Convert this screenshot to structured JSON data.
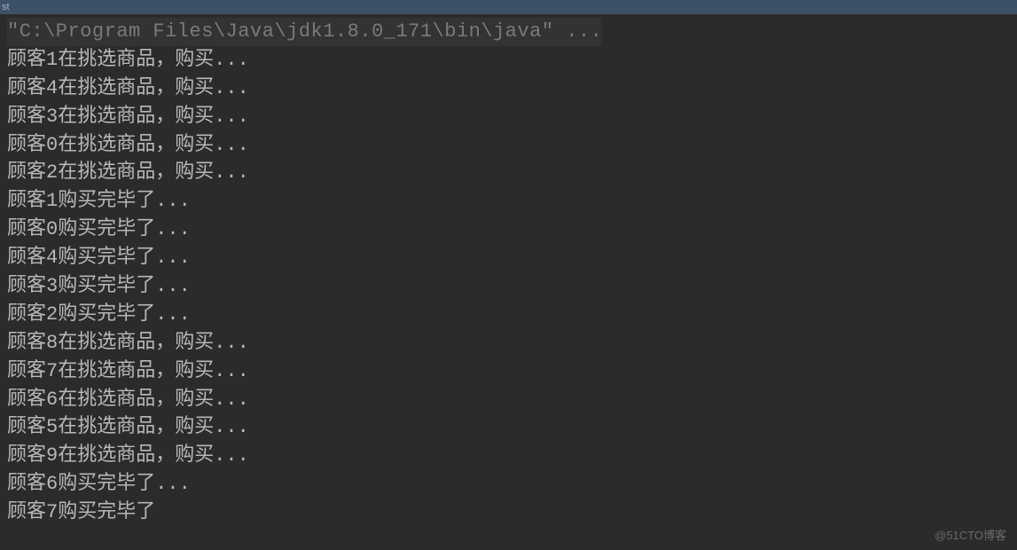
{
  "title_bar": {
    "text": "st"
  },
  "console": {
    "command": "\"C:\\Program Files\\Java\\jdk1.8.0_171\\bin\\java\" ...",
    "lines": [
      "顾客1在挑选商品，购买...",
      "顾客4在挑选商品，购买...",
      "顾客3在挑选商品，购买...",
      "顾客0在挑选商品，购买...",
      "顾客2在挑选商品，购买...",
      "顾客1购买完毕了...",
      "顾客0购买完毕了...",
      "顾客4购买完毕了...",
      "顾客3购买完毕了...",
      "顾客2购买完毕了...",
      "顾客8在挑选商品，购买...",
      "顾客7在挑选商品，购买...",
      "顾客6在挑选商品，购买...",
      "顾客5在挑选商品，购买...",
      "顾客9在挑选商品，购买...",
      "顾客6购买完毕了...",
      "顾客7购买完毕了"
    ]
  },
  "watermark": "@51CTO博客"
}
